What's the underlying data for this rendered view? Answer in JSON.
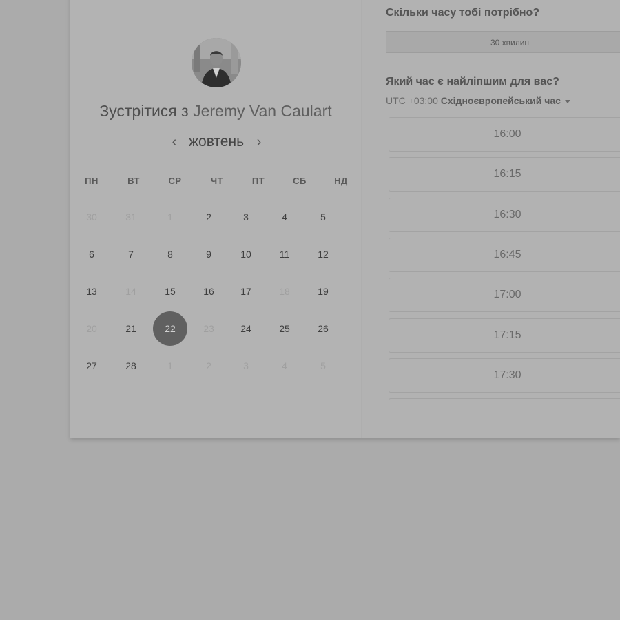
{
  "host": {
    "title_prefix": "Зустрітися з",
    "name": "Jeremy Van Caulart"
  },
  "calendar": {
    "month": "жовтень",
    "weekdays": [
      "ПН",
      "ВТ",
      "СР",
      "ЧТ",
      "ПТ",
      "СБ",
      "НД"
    ],
    "weeks": [
      [
        {
          "d": "30",
          "muted": true
        },
        {
          "d": "31",
          "muted": true
        },
        {
          "d": "1",
          "muted": true
        },
        {
          "d": "2"
        },
        {
          "d": "3"
        },
        {
          "d": "4"
        },
        {
          "d": "5"
        }
      ],
      [
        {
          "d": "6"
        },
        {
          "d": "7"
        },
        {
          "d": "8"
        },
        {
          "d": "9"
        },
        {
          "d": "10"
        },
        {
          "d": "11"
        },
        {
          "d": "12"
        }
      ],
      [
        {
          "d": "13"
        },
        {
          "d": "14",
          "muted": true
        },
        {
          "d": "15"
        },
        {
          "d": "16"
        },
        {
          "d": "17"
        },
        {
          "d": "18",
          "muted": true
        },
        {
          "d": "19"
        }
      ],
      [
        {
          "d": "20",
          "muted": true
        },
        {
          "d": "21"
        },
        {
          "d": "22",
          "selected": true
        },
        {
          "d": "23",
          "muted": true
        },
        {
          "d": "24"
        },
        {
          "d": "25"
        },
        {
          "d": "26"
        }
      ],
      [
        {
          "d": "27"
        },
        {
          "d": "28"
        },
        {
          "d": "1",
          "muted": true
        },
        {
          "d": "2",
          "muted": true
        },
        {
          "d": "3",
          "muted": true
        },
        {
          "d": "4",
          "muted": true
        },
        {
          "d": "5",
          "muted": true
        }
      ]
    ]
  },
  "booking": {
    "duration_question": "Скільки часу тобі потрібно?",
    "duration_value": "30 хвилин",
    "time_question": "Який час є найліпшим для вас?",
    "timezone_offset": "UTC +03:00",
    "timezone_name": "Східноєвропейський час",
    "slots": [
      "16:00",
      "16:15",
      "16:30",
      "16:45",
      "17:00",
      "17:15",
      "17:30",
      ""
    ]
  },
  "colors": {
    "overlay_background": "#ababab",
    "selected_day": "#606060"
  },
  "icons": {
    "prev": "chevron-left-icon",
    "next": "chevron-right-icon",
    "timezone_dropdown": "caret-down-icon"
  }
}
